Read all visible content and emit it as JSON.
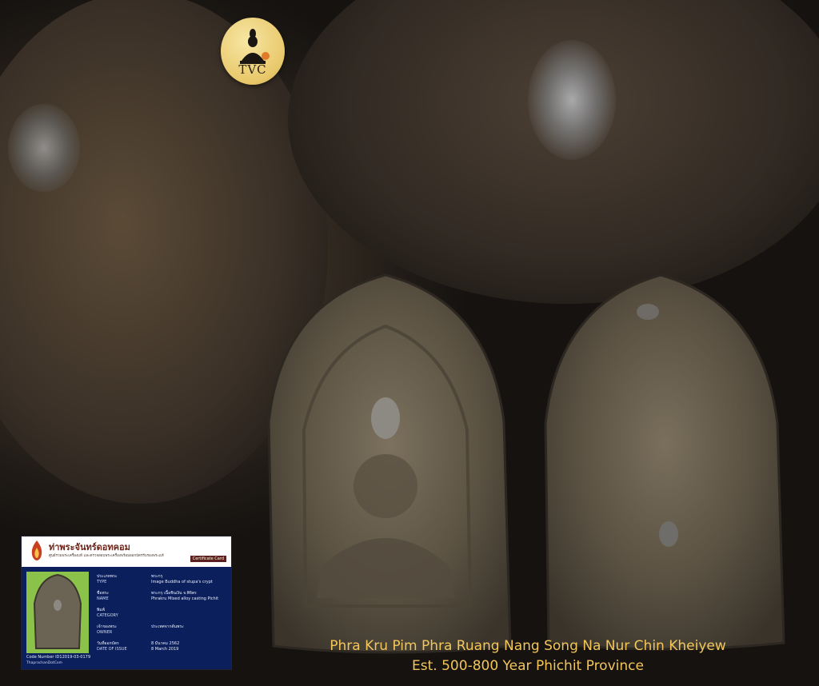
{
  "logo": {
    "text": "TVC"
  },
  "certificate": {
    "brand": "ท่าพระจันทร์ดอทคอม",
    "subtitle": "ศูนย์รวมพระเครื่องแท้ และตรวจสอบพระเครื่องพร้อมออกบัตรรับรองพระแท้",
    "card_label": "Certificate Card",
    "rows": [
      {
        "label_th": "ประเภทพระ",
        "label_en": "TYPE",
        "value_th": "พระกรุ",
        "value_en": "Image Buddha of stupa's crypt"
      },
      {
        "label_th": "ชื่อพระ",
        "label_en": "NAME",
        "value_th": "พระกรุ เนื้อชินเงิน จ.พิจิตร",
        "value_en": "Phrakru Mixed alloy casting Pichit"
      },
      {
        "label_th": "พิมพ์",
        "label_en": "CATEGORY",
        "value_th": "",
        "value_en": ""
      },
      {
        "label_th": "เจ้าของพระ",
        "label_en": "OWNER",
        "value_th": "ประเทศจากต้นพระ",
        "value_en": ""
      },
      {
        "label_th": "วันที่ออกบัตร",
        "label_en": "DATE OF ISSUE",
        "value_th": "8 มีนาคม 2562",
        "value_en": "8 March 2019"
      }
    ],
    "code_label": "Code Number",
    "code_value": "ID12019-03-0179",
    "site": "ThaprachanDotCom"
  },
  "caption": {
    "line1": "Phra Kru Pim Phra Ruang Nang Song Na Nur Chin Kheiyew",
    "line2": "Est. 500-800 Year Phichit Province"
  }
}
